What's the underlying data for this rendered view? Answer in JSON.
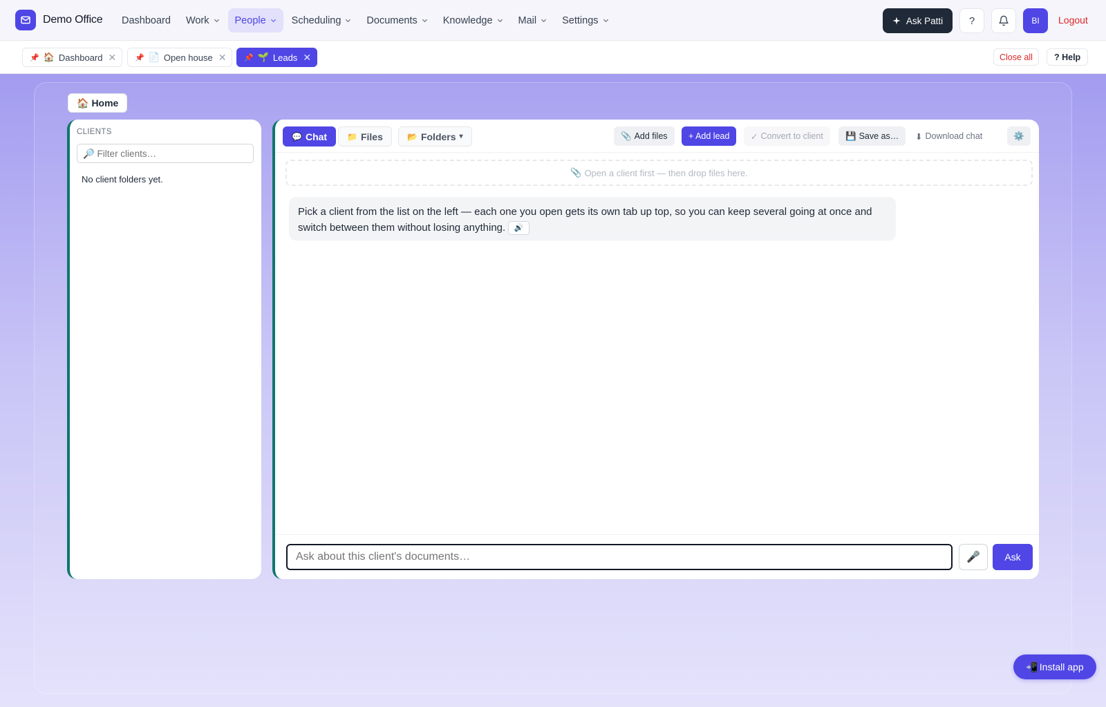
{
  "app": {
    "brand": "Demo Office",
    "accent": "#4f46e5"
  },
  "nav": {
    "items": [
      {
        "label": "Dashboard",
        "has_menu": false,
        "active": false
      },
      {
        "label": "Work",
        "has_menu": true,
        "active": false
      },
      {
        "label": "People",
        "has_menu": true,
        "active": true
      },
      {
        "label": "Scheduling",
        "has_menu": true,
        "active": false
      },
      {
        "label": "Documents",
        "has_menu": true,
        "active": false
      },
      {
        "label": "Knowledge",
        "has_menu": true,
        "active": false
      },
      {
        "label": "Mail",
        "has_menu": true,
        "active": false
      },
      {
        "label": "Settings",
        "has_menu": true,
        "active": false
      }
    ],
    "ask_label": "Ask Patti",
    "help_glyph": "?",
    "avatar_initials": "BI",
    "logout_label": "Logout"
  },
  "tabs": {
    "items": [
      {
        "pin": "📌",
        "emoji": "🏠",
        "label": "Dashboard",
        "close": "✕",
        "active": false
      },
      {
        "pin": "📌",
        "emoji": "📄",
        "label": "Open house",
        "close": "✕",
        "active": false
      },
      {
        "pin": "📌",
        "emoji": "🌱",
        "label": "Leads",
        "close": "✕",
        "active": true
      }
    ],
    "close_all_label": "Close all",
    "help_label": "? Help"
  },
  "home": {
    "icon": "🏠",
    "label": "Home"
  },
  "clients": {
    "heading": "CLIENTS",
    "filter_placeholder": "🔎 Filter clients…",
    "empty_text": "No client folders yet."
  },
  "chat": {
    "tabs": {
      "chat": {
        "icon": "💬",
        "label": "Chat"
      },
      "files": {
        "icon": "📁",
        "label": "Files"
      },
      "folders": {
        "icon": "📂",
        "label": "Folders",
        "caret": "▾"
      }
    },
    "actions": {
      "add_files": {
        "icon": "📎",
        "label": "Add files"
      },
      "add_lead": "+ Add lead",
      "convert": {
        "icon": "✓",
        "label": "Convert to client"
      },
      "save_as": {
        "icon": "💾",
        "label": "Save as…"
      },
      "download": {
        "icon": "⬇",
        "label": "Download chat"
      },
      "settings_icon": "⚙️"
    },
    "dropzone": {
      "icon": "📎",
      "text": "Open a client first — then drop files here."
    },
    "message": {
      "text": "Pick a client from the list on the left — each one you open gets its own tab up top, so you can keep several going at once and switch between them without losing anything.",
      "speak_icon": "🔊"
    },
    "composer": {
      "placeholder": "Ask about this client's documents…",
      "mic_icon": "🎤",
      "send_label": "Ask"
    }
  },
  "install": {
    "icon": "📲",
    "label": "Install app"
  }
}
